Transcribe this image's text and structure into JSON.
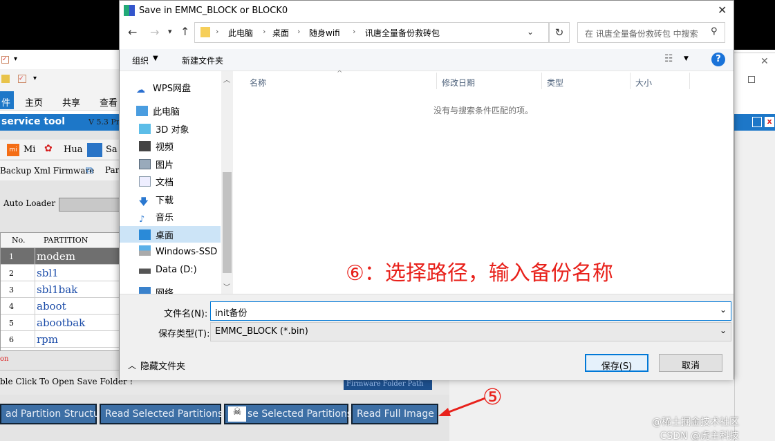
{
  "dialog": {
    "title": "Save in EMMC_BLOCK or BLOCK0",
    "breadcrumb": [
      "此电脑",
      "桌面",
      "随身wifi",
      "讯唐全量备份救砖包"
    ],
    "search_placeholder": "在 讯唐全量备份救砖包 中搜索",
    "toolbar": {
      "organize": "组织",
      "new_folder": "新建文件夹"
    },
    "nav": [
      {
        "label": "WPS网盘",
        "icon": "cloud-icon"
      },
      {
        "label": "此电脑",
        "icon": "computer-icon"
      },
      {
        "label": "3D 对象",
        "icon": "cube-icon"
      },
      {
        "label": "视频",
        "icon": "video-icon"
      },
      {
        "label": "图片",
        "icon": "picture-icon"
      },
      {
        "label": "文档",
        "icon": "document-icon"
      },
      {
        "label": "下载",
        "icon": "download-icon"
      },
      {
        "label": "音乐",
        "icon": "music-icon"
      },
      {
        "label": "桌面",
        "icon": "desktop-icon",
        "selected": true
      },
      {
        "label": "Windows-SSD",
        "icon": "drive-icon"
      },
      {
        "label": "Data (D:)",
        "icon": "drive-icon"
      },
      {
        "label": "网络",
        "icon": "network-icon"
      }
    ],
    "columns": [
      "名称",
      "修改日期",
      "类型",
      "大小"
    ],
    "empty_message": "没有与搜索条件匹配的项。",
    "filename_label": "文件名(N):",
    "filename_value": "init备份",
    "filetype_label": "保存类型(T):",
    "filetype_value": "EMMC_BLOCK  (*.bin)",
    "hide_folders": "隐藏文件夹",
    "save_button": "保存(S)",
    "cancel_button": "取消"
  },
  "background_app": {
    "ribbon_tabs": [
      "件",
      "主页",
      "共享",
      "查看"
    ],
    "title": "service tool",
    "version": "V 5.3 Pr",
    "brands": [
      "Mi",
      "Hua",
      "Sa"
    ],
    "sub_items": [
      "Backup Xml Firmware",
      "Par"
    ],
    "auto_loader": "Auto Loader",
    "table_headers": [
      "No.",
      "PARTITION"
    ],
    "partitions": [
      {
        "no": "1",
        "name": "modem"
      },
      {
        "no": "2",
        "name": "sbl1"
      },
      {
        "no": "3",
        "name": "sbl1bak"
      },
      {
        "no": "4",
        "name": "aboot"
      },
      {
        "no": "5",
        "name": "abootbak"
      },
      {
        "no": "6",
        "name": "rpm"
      }
    ],
    "status_red": "on",
    "double_click_hint": "ble Click To Open Save Folder !",
    "firmware_folder_path": "Firmware Folder Path",
    "buttons": [
      "ad Partition Structure",
      "Read Selected Partitions",
      "se Selected Partitions",
      "Read Full Image"
    ]
  },
  "annotations": {
    "step6": "⑥：选择路径，输入备份名称",
    "step5": "⑤"
  },
  "watermark": [
    "@稀土掘金技术社区",
    "CSDN @虎主科技"
  ],
  "colors": {
    "accent": "#0078d7",
    "annotation_red": "#e8211b",
    "tool_blue": "#1d77c8"
  }
}
